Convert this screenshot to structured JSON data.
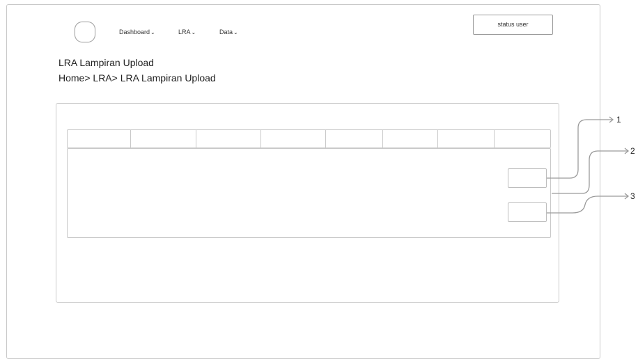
{
  "nav": {
    "items": [
      {
        "label": "Dashboard",
        "chevron": "⌄"
      },
      {
        "label": "LRA",
        "chevron": "⌄"
      },
      {
        "label": "Data",
        "chevron": "⌄"
      }
    ]
  },
  "header": {
    "status_label": "status user"
  },
  "page": {
    "title": "LRA Lampiran Upload",
    "breadcrumb": "Home> LRA> LRA Lampiran Upload"
  },
  "annotations": [
    "1",
    "2",
    "3"
  ]
}
